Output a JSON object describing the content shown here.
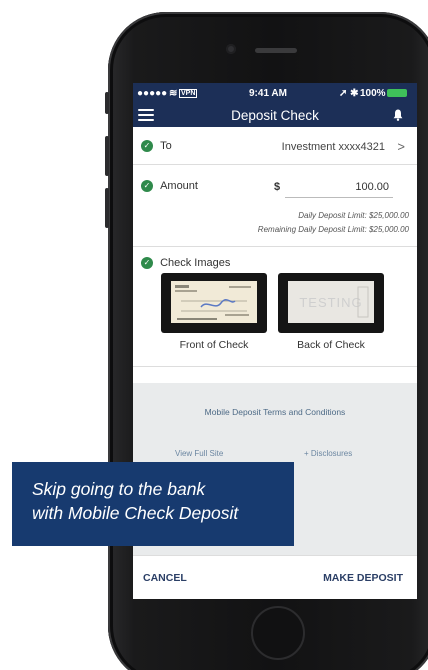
{
  "status_bar": {
    "signal": "●●●●● ",
    "wifi": "≋",
    "vpn": "VPN",
    "time": "9:41 AM",
    "location_bluetooth": "➚ ✱",
    "battery": "100%"
  },
  "nav": {
    "title": "Deposit Check"
  },
  "to_row": {
    "label": "To",
    "value": "Investment xxxx4321",
    "chevron": ">"
  },
  "amount_row": {
    "label": "Amount",
    "currency": "$",
    "value": "100.00",
    "daily_limit": "Daily Deposit Limit: $25,000.00",
    "remaining_limit": "Remaining Daily Deposit Limit: $25,000.00"
  },
  "check_images": {
    "label": "Check Images",
    "front_caption": "Front of Check",
    "back_caption": "Back of Check",
    "back_watermark": "TESTING"
  },
  "footer_links": {
    "terms": "Mobile Deposit Terms and Conditions",
    "view_full_site": "View Full Site",
    "disclosures": "+ Disclosures"
  },
  "actions": {
    "cancel": "CANCEL",
    "make_deposit": "MAKE DEPOSIT"
  },
  "banner": {
    "line1": "Skip going to the bank",
    "line2": "with Mobile Check Deposit"
  },
  "colors": {
    "navy": "#1c2f57",
    "check_green": "#2f8a4b",
    "banner_blue": "#173a6f",
    "footer_gray": "#e9ebec"
  }
}
